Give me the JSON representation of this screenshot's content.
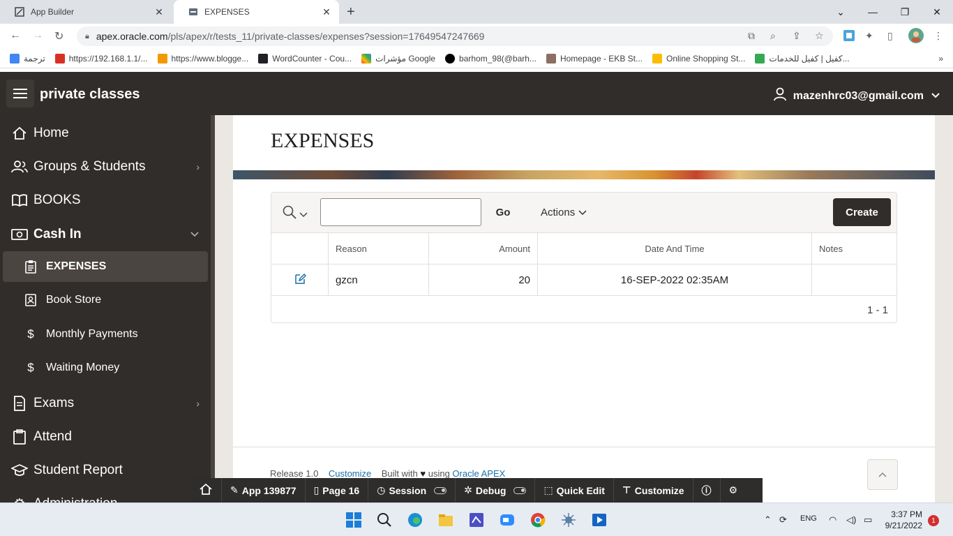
{
  "browser": {
    "tabs": [
      {
        "label": "App Builder",
        "active": false
      },
      {
        "label": "EXPENSES",
        "active": true
      }
    ],
    "url_host": "apex.oracle.com",
    "url_path": "/pls/apex/r/tests_11/private-classes/expenses?session=17649547247669",
    "bookmarks": [
      "ترجمة",
      "https://192.168.1.1/...",
      "https://www.blogge...",
      "WordCounter - Cou...",
      "مؤشرات Google",
      "barhom_98(@barh...",
      "Homepage - EKB St...",
      "Online Shopping St...",
      "كفيل | كفيل للخدمات..."
    ],
    "more_bookmarks": "»"
  },
  "header": {
    "app_title": "private classes",
    "user": "mazenhrc03@gmail.com"
  },
  "sidebar": {
    "items": [
      {
        "label": "Home",
        "icon": "home-icon"
      },
      {
        "label": "Groups & Students",
        "icon": "users-icon",
        "chevron": "›"
      },
      {
        "label": "BOOKS",
        "icon": "book-icon"
      },
      {
        "label": "Cash In",
        "icon": "money-icon",
        "chevron": "⌄"
      },
      {
        "label": "EXPENSES",
        "icon": "clipboard-icon",
        "active": true
      },
      {
        "label": "Book Store",
        "icon": "contact-icon"
      },
      {
        "label": "Monthly Payments",
        "icon": "dollar-icon"
      },
      {
        "label": "Waiting Money",
        "icon": "dollar-icon"
      },
      {
        "label": "Exams",
        "icon": "document-icon",
        "chevron": "›"
      },
      {
        "label": "Attend",
        "icon": "clipboard-check-icon"
      },
      {
        "label": "Student Report",
        "icon": "graduation-icon"
      },
      {
        "label": "Administration",
        "icon": "gear-icon"
      }
    ]
  },
  "page": {
    "title": "EXPENSES"
  },
  "report": {
    "search_value": "",
    "go_label": "Go",
    "actions_label": "Actions",
    "create_label": "Create",
    "columns": [
      "",
      "Reason",
      "Amount",
      "Date And Time",
      "Notes"
    ],
    "rows": [
      {
        "reason": "gzcn",
        "amount": "20",
        "date": "16-SEP-2022 02:35AM",
        "notes": ""
      }
    ],
    "pagination": "1 - 1"
  },
  "footer": {
    "release": "Release 1.0",
    "customize": "Customize",
    "built_with": "Built with",
    "using": "using",
    "oracle_apex": "Oracle APEX"
  },
  "devbar": {
    "app": "App 139877",
    "page": "Page 16",
    "session": "Session",
    "debug": "Debug",
    "quick_edit": "Quick Edit",
    "customize": "Customize"
  },
  "taskbar": {
    "lang": "ENG",
    "time": "3:37 PM",
    "date": "9/21/2022",
    "notifications": "1"
  },
  "colors": {
    "header_bg": "#312d2a",
    "create_btn": "#312d2a",
    "link": "#1a6fa7"
  }
}
